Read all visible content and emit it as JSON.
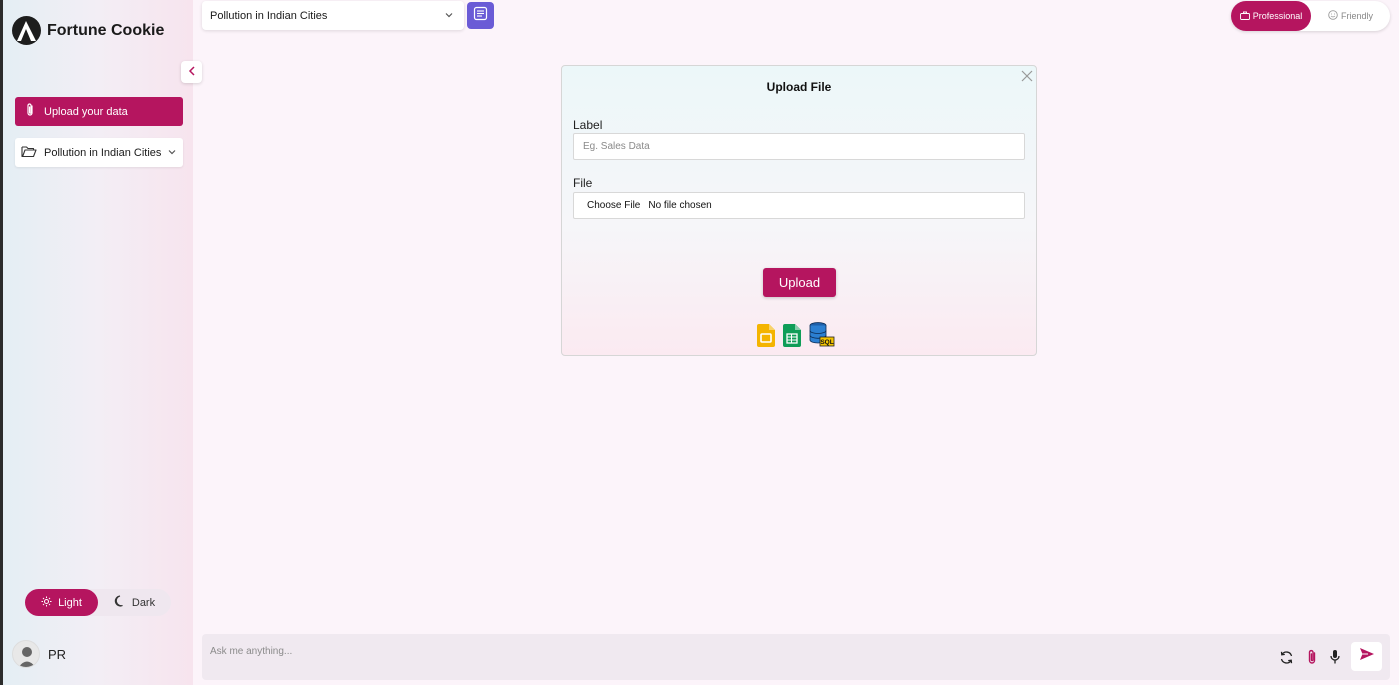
{
  "app": {
    "name": "Fortune Cookie",
    "logo_icon": "fortune-cookie-logo"
  },
  "sidebar": {
    "upload_button": {
      "label": "Upload your data",
      "icon": "paperclip-icon"
    },
    "dataset_select": {
      "value": "Pollution in Indian Cities",
      "icon": "folder-open-icon"
    },
    "theme": {
      "light_label": "Light",
      "dark_label": "Dark",
      "active": "Light"
    },
    "user": {
      "initials": "PR"
    }
  },
  "header": {
    "dataset_select": {
      "value": "Pollution in Indian Cities"
    },
    "tone": {
      "professional_label": "Professional",
      "friendly_label": "Friendly",
      "active": "Professional"
    }
  },
  "modal": {
    "title": "Upload File",
    "label_field": {
      "label": "Label",
      "placeholder": "Eg. Sales Data",
      "value": ""
    },
    "file_field": {
      "label": "File",
      "button_label": "Choose File",
      "status": "No file chosen"
    },
    "submit_label": "Upload",
    "source_icons": [
      "google-slides-icon",
      "google-sheets-icon",
      "sql-database-icon"
    ]
  },
  "chat": {
    "placeholder": "Ask me anything...",
    "actions": [
      "refresh-icon",
      "paperclip-icon",
      "microphone-icon",
      "send-icon"
    ]
  },
  "colors": {
    "accent": "#b5155f",
    "doc_button": "#6a5bd6",
    "background": "#fcf4fa"
  }
}
